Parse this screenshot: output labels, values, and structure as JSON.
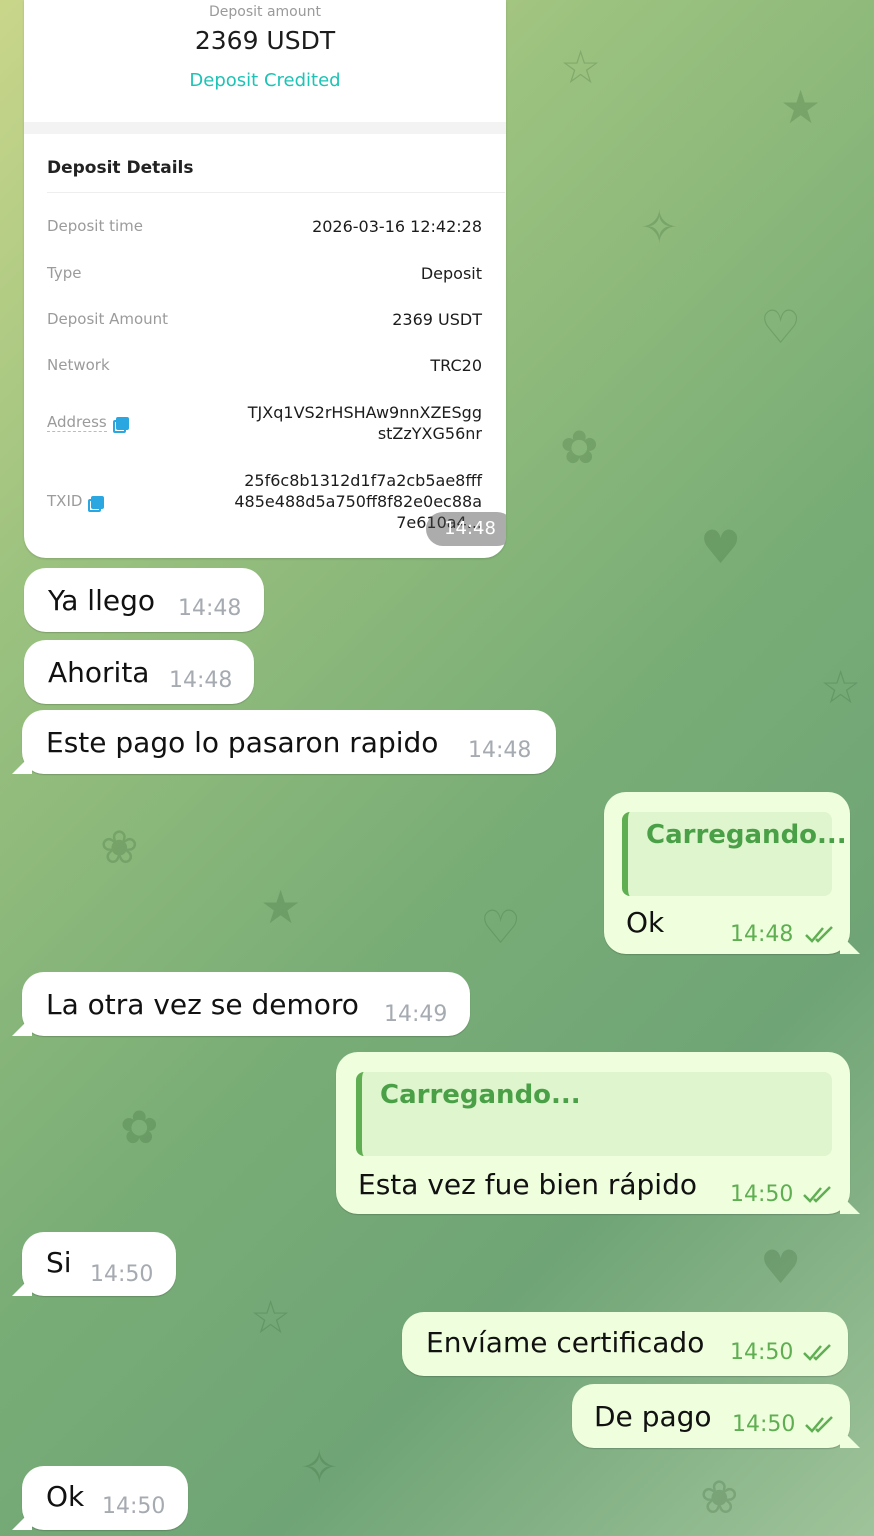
{
  "screenshot_card": {
    "caption_label": "Deposit amount",
    "amount": "2369 USDT",
    "status": "Deposit Credited",
    "details_title": "Deposit Details",
    "rows": [
      {
        "label": "Deposit time",
        "value": "2026-03-16 12:42:28"
      },
      {
        "label": "Type",
        "value": "Deposit"
      },
      {
        "label": "Deposit Amount",
        "value": "2369 USDT"
      },
      {
        "label": "Network",
        "value": "TRC20"
      },
      {
        "label": "Address",
        "value": [
          "TJXq1VS2rHSHAw9nnXZESgg",
          "stZzYXG56nr"
        ]
      },
      {
        "label": "TXID",
        "value": [
          "25f6c8b1312d1f7a2cb5ae8fff",
          "485e488d5a750ff8f82e0ec88a",
          "7e610a4..."
        ]
      }
    ],
    "time": "14:48"
  },
  "messages": [
    {
      "dir": "in",
      "text": "Ya llego",
      "time": "14:48"
    },
    {
      "dir": "in",
      "text": "Ahorita",
      "time": "14:48"
    },
    {
      "dir": "in",
      "text": "Este pago lo pasaron rapido",
      "time": "14:48"
    },
    {
      "dir": "out",
      "reply": "Carregando...",
      "text": "Ok",
      "time": "14:48"
    },
    {
      "dir": "in",
      "text": "La otra vez se demoro",
      "time": "14:49"
    },
    {
      "dir": "out",
      "reply": "Carregando...",
      "text": "Esta vez fue bien rápido",
      "time": "14:50"
    },
    {
      "dir": "in",
      "text": "Si",
      "time": "14:50"
    },
    {
      "dir": "out",
      "text": "Envíame certificado",
      "time": "14:50"
    },
    {
      "dir": "out",
      "text": "De pago",
      "time": "14:50"
    },
    {
      "dir": "in",
      "text": "Ok",
      "time": "14:50"
    }
  ],
  "icons": {
    "read_status": "double-check-icon",
    "copy": "copy-icon"
  },
  "colors": {
    "incoming_bubble": "#ffffff",
    "outgoing_bubble": "#efffde",
    "accent_green": "#5fae52",
    "credited_teal": "#1ec3b6"
  }
}
